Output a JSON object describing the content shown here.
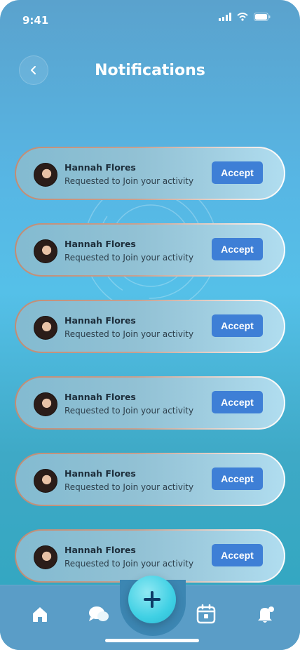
{
  "status_bar": {
    "time": "9:41",
    "icons": [
      "signal-icon",
      "wifi-icon",
      "battery-icon"
    ]
  },
  "header": {
    "title": "Notifications",
    "back_icon": "chevron-left-icon"
  },
  "notifications": [
    {
      "name": "Hannah Flores",
      "message": "Requested to Join your activity",
      "action": "Accept"
    },
    {
      "name": "Hannah Flores",
      "message": "Requested to Join your activity",
      "action": "Accept"
    },
    {
      "name": "Hannah Flores",
      "message": "Requested to Join your activity",
      "action": "Accept"
    },
    {
      "name": "Hannah Flores",
      "message": "Requested to Join your activity",
      "action": "Accept"
    },
    {
      "name": "Hannah Flores",
      "message": "Requested to Join your activity",
      "action": "Accept"
    },
    {
      "name": "Hannah Flores",
      "message": "Requested to Join your activity",
      "action": "Accept"
    }
  ],
  "bottom_nav": {
    "items": [
      "home-icon",
      "chat-icon",
      "add-icon",
      "calendar-icon",
      "bell-icon"
    ],
    "active": "bell-icon"
  },
  "colors": {
    "accent": "#3e7fd6",
    "background_top": "#5aa2cd",
    "background_bottom": "#2fa6bf",
    "nav": "#5a9dc7",
    "fab": "#3fd0e4"
  }
}
